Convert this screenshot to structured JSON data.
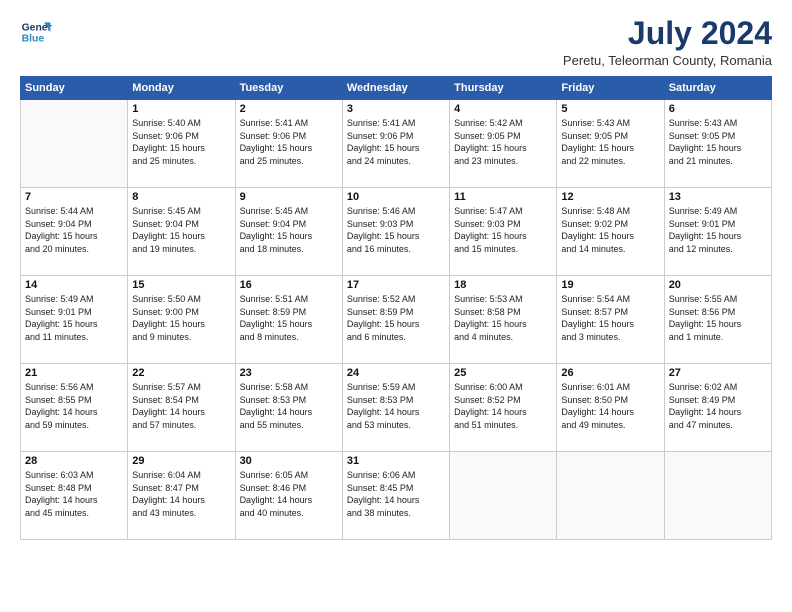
{
  "logo": {
    "line1": "General",
    "line2": "Blue"
  },
  "title": "July 2024",
  "location": "Peretu, Teleorman County, Romania",
  "weekdays": [
    "Sunday",
    "Monday",
    "Tuesday",
    "Wednesday",
    "Thursday",
    "Friday",
    "Saturday"
  ],
  "weeks": [
    [
      {
        "day": "",
        "info": ""
      },
      {
        "day": "1",
        "info": "Sunrise: 5:40 AM\nSunset: 9:06 PM\nDaylight: 15 hours\nand 25 minutes."
      },
      {
        "day": "2",
        "info": "Sunrise: 5:41 AM\nSunset: 9:06 PM\nDaylight: 15 hours\nand 25 minutes."
      },
      {
        "day": "3",
        "info": "Sunrise: 5:41 AM\nSunset: 9:06 PM\nDaylight: 15 hours\nand 24 minutes."
      },
      {
        "day": "4",
        "info": "Sunrise: 5:42 AM\nSunset: 9:05 PM\nDaylight: 15 hours\nand 23 minutes."
      },
      {
        "day": "5",
        "info": "Sunrise: 5:43 AM\nSunset: 9:05 PM\nDaylight: 15 hours\nand 22 minutes."
      },
      {
        "day": "6",
        "info": "Sunrise: 5:43 AM\nSunset: 9:05 PM\nDaylight: 15 hours\nand 21 minutes."
      }
    ],
    [
      {
        "day": "7",
        "info": "Sunrise: 5:44 AM\nSunset: 9:04 PM\nDaylight: 15 hours\nand 20 minutes."
      },
      {
        "day": "8",
        "info": "Sunrise: 5:45 AM\nSunset: 9:04 PM\nDaylight: 15 hours\nand 19 minutes."
      },
      {
        "day": "9",
        "info": "Sunrise: 5:45 AM\nSunset: 9:04 PM\nDaylight: 15 hours\nand 18 minutes."
      },
      {
        "day": "10",
        "info": "Sunrise: 5:46 AM\nSunset: 9:03 PM\nDaylight: 15 hours\nand 16 minutes."
      },
      {
        "day": "11",
        "info": "Sunrise: 5:47 AM\nSunset: 9:03 PM\nDaylight: 15 hours\nand 15 minutes."
      },
      {
        "day": "12",
        "info": "Sunrise: 5:48 AM\nSunset: 9:02 PM\nDaylight: 15 hours\nand 14 minutes."
      },
      {
        "day": "13",
        "info": "Sunrise: 5:49 AM\nSunset: 9:01 PM\nDaylight: 15 hours\nand 12 minutes."
      }
    ],
    [
      {
        "day": "14",
        "info": "Sunrise: 5:49 AM\nSunset: 9:01 PM\nDaylight: 15 hours\nand 11 minutes."
      },
      {
        "day": "15",
        "info": "Sunrise: 5:50 AM\nSunset: 9:00 PM\nDaylight: 15 hours\nand 9 minutes."
      },
      {
        "day": "16",
        "info": "Sunrise: 5:51 AM\nSunset: 8:59 PM\nDaylight: 15 hours\nand 8 minutes."
      },
      {
        "day": "17",
        "info": "Sunrise: 5:52 AM\nSunset: 8:59 PM\nDaylight: 15 hours\nand 6 minutes."
      },
      {
        "day": "18",
        "info": "Sunrise: 5:53 AM\nSunset: 8:58 PM\nDaylight: 15 hours\nand 4 minutes."
      },
      {
        "day": "19",
        "info": "Sunrise: 5:54 AM\nSunset: 8:57 PM\nDaylight: 15 hours\nand 3 minutes."
      },
      {
        "day": "20",
        "info": "Sunrise: 5:55 AM\nSunset: 8:56 PM\nDaylight: 15 hours\nand 1 minute."
      }
    ],
    [
      {
        "day": "21",
        "info": "Sunrise: 5:56 AM\nSunset: 8:55 PM\nDaylight: 14 hours\nand 59 minutes."
      },
      {
        "day": "22",
        "info": "Sunrise: 5:57 AM\nSunset: 8:54 PM\nDaylight: 14 hours\nand 57 minutes."
      },
      {
        "day": "23",
        "info": "Sunrise: 5:58 AM\nSunset: 8:53 PM\nDaylight: 14 hours\nand 55 minutes."
      },
      {
        "day": "24",
        "info": "Sunrise: 5:59 AM\nSunset: 8:53 PM\nDaylight: 14 hours\nand 53 minutes."
      },
      {
        "day": "25",
        "info": "Sunrise: 6:00 AM\nSunset: 8:52 PM\nDaylight: 14 hours\nand 51 minutes."
      },
      {
        "day": "26",
        "info": "Sunrise: 6:01 AM\nSunset: 8:50 PM\nDaylight: 14 hours\nand 49 minutes."
      },
      {
        "day": "27",
        "info": "Sunrise: 6:02 AM\nSunset: 8:49 PM\nDaylight: 14 hours\nand 47 minutes."
      }
    ],
    [
      {
        "day": "28",
        "info": "Sunrise: 6:03 AM\nSunset: 8:48 PM\nDaylight: 14 hours\nand 45 minutes."
      },
      {
        "day": "29",
        "info": "Sunrise: 6:04 AM\nSunset: 8:47 PM\nDaylight: 14 hours\nand 43 minutes."
      },
      {
        "day": "30",
        "info": "Sunrise: 6:05 AM\nSunset: 8:46 PM\nDaylight: 14 hours\nand 40 minutes."
      },
      {
        "day": "31",
        "info": "Sunrise: 6:06 AM\nSunset: 8:45 PM\nDaylight: 14 hours\nand 38 minutes."
      },
      {
        "day": "",
        "info": ""
      },
      {
        "day": "",
        "info": ""
      },
      {
        "day": "",
        "info": ""
      }
    ]
  ]
}
